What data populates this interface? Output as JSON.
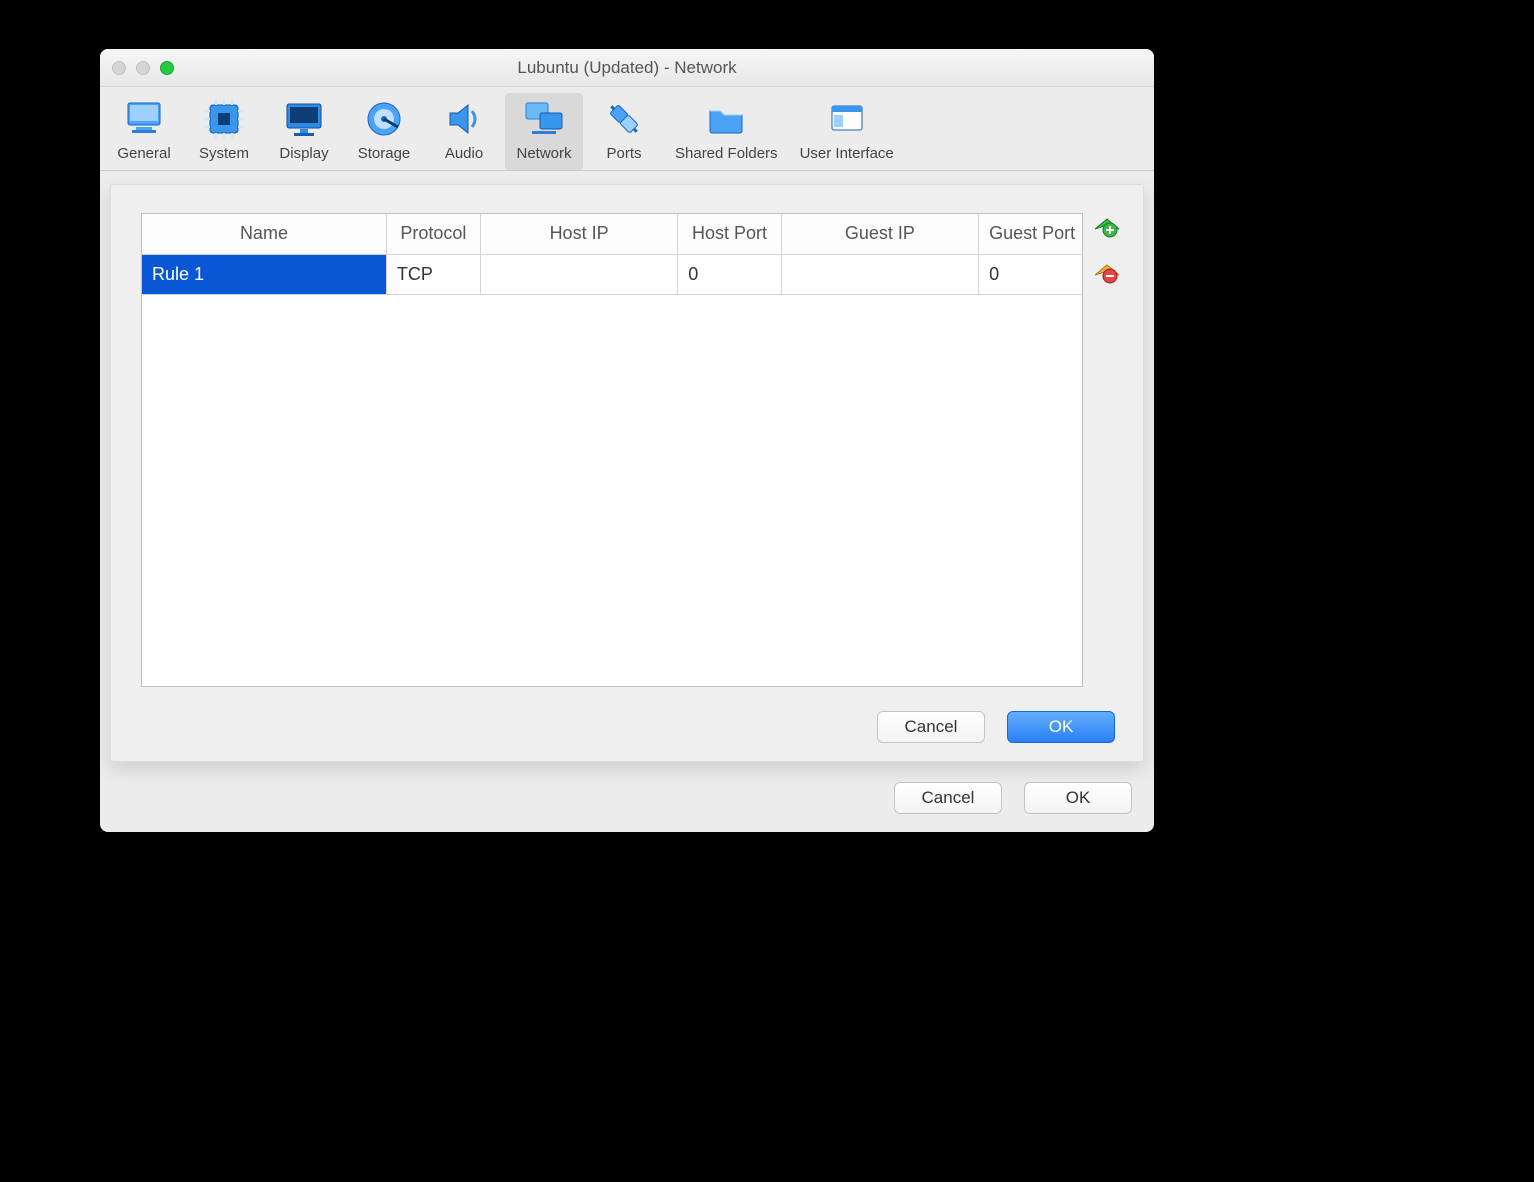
{
  "window": {
    "title": "Lubuntu (Updated) - Network"
  },
  "toolbar": {
    "items": [
      {
        "label": "General"
      },
      {
        "label": "System"
      },
      {
        "label": "Display"
      },
      {
        "label": "Storage"
      },
      {
        "label": "Audio"
      },
      {
        "label": "Network",
        "selected": true
      },
      {
        "label": "Ports"
      },
      {
        "label": "Shared Folders"
      },
      {
        "label": "User Interface"
      }
    ]
  },
  "table": {
    "headers": {
      "name": "Name",
      "protocol": "Protocol",
      "host_ip": "Host IP",
      "host_port": "Host Port",
      "guest_ip": "Guest IP",
      "guest_port": "Guest Port"
    },
    "rows": [
      {
        "name": "Rule 1",
        "protocol": "TCP",
        "host_ip": "",
        "host_port": "0",
        "guest_ip": "",
        "guest_port": "0",
        "selected": true
      }
    ]
  },
  "panel_buttons": {
    "cancel": "Cancel",
    "ok": "OK"
  },
  "outer_buttons": {
    "cancel": "Cancel",
    "ok": "OK"
  }
}
